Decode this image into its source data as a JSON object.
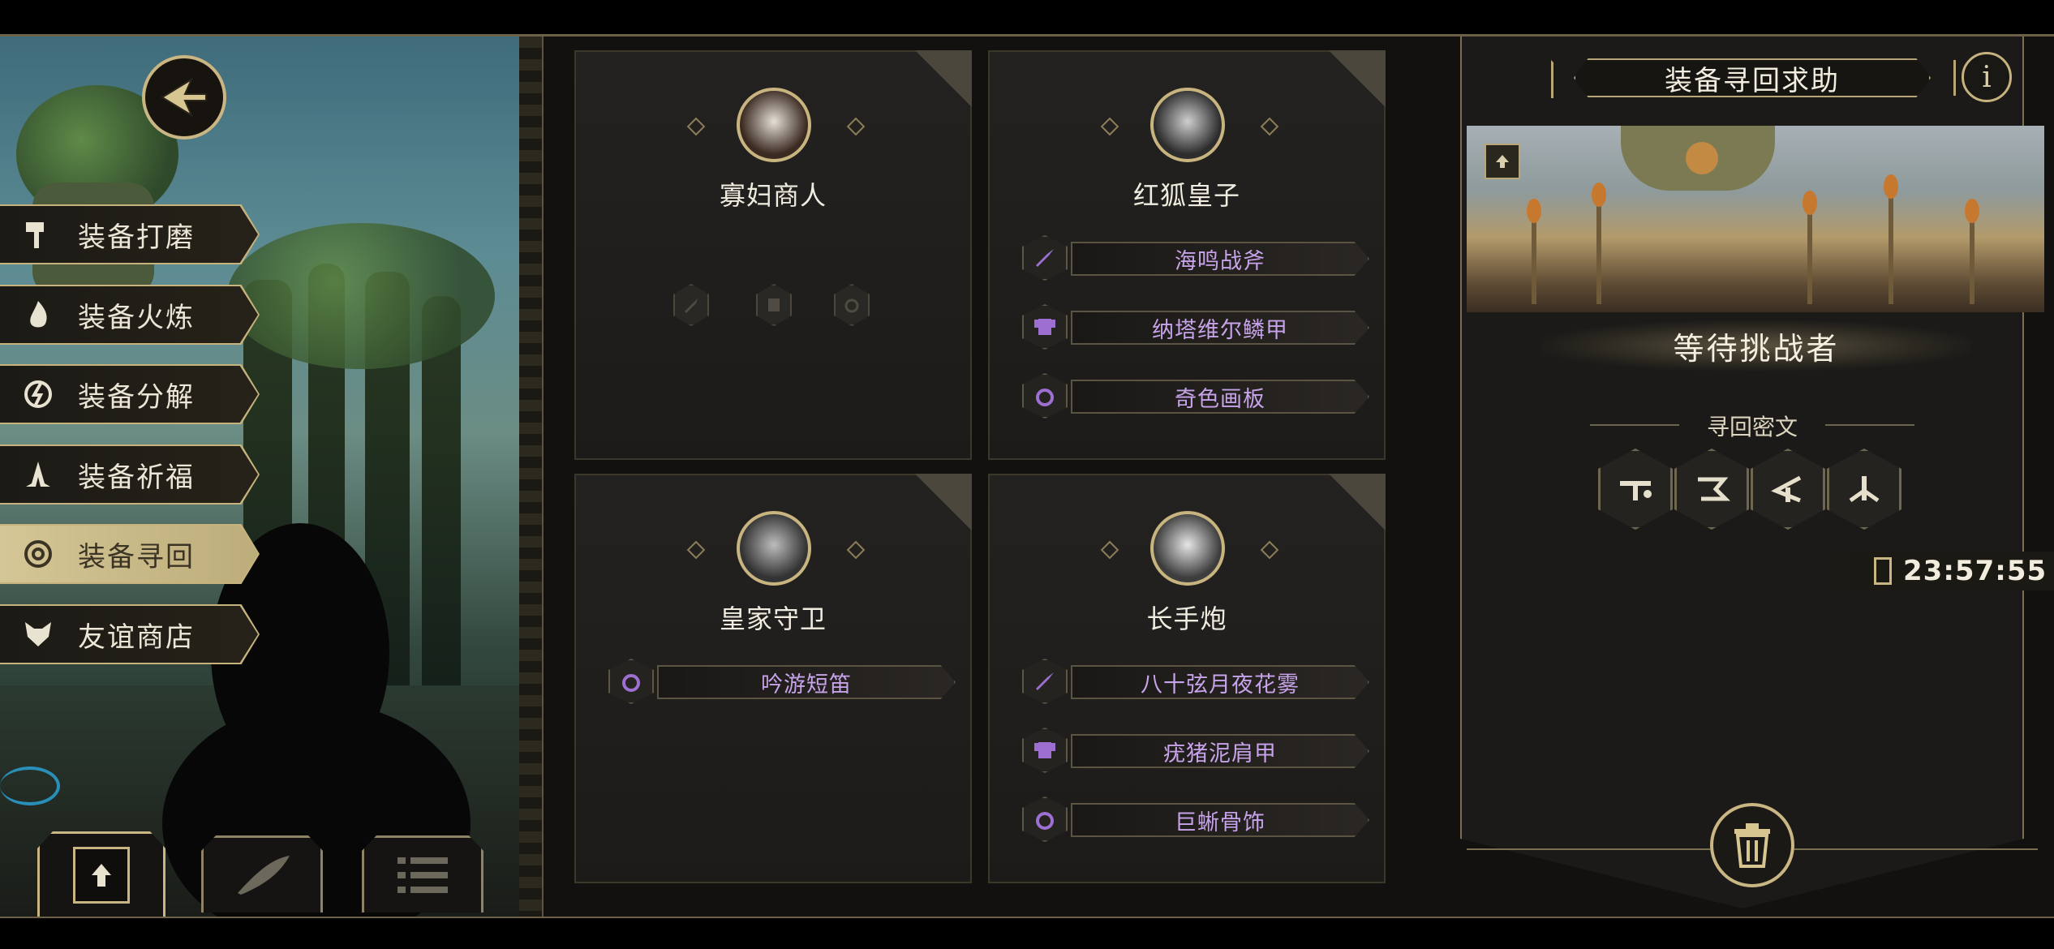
{
  "left_menu": {
    "items": [
      {
        "label": "装备打磨",
        "icon": "hammer-icon"
      },
      {
        "label": "装备火炼",
        "icon": "flame-icon"
      },
      {
        "label": "装备分解",
        "icon": "split-icon"
      },
      {
        "label": "装备祈福",
        "icon": "pray-hands-icon"
      },
      {
        "label": "装备寻回",
        "icon": "target-icon",
        "active": true
      },
      {
        "label": "友谊商店",
        "icon": "fox-icon"
      }
    ]
  },
  "cards": [
    {
      "name": "寡妇商人",
      "items": []
    },
    {
      "name": "红狐皇子",
      "items": [
        {
          "label": "海鸣战斧",
          "type": "sword-icon"
        },
        {
          "label": "纳塔维尔鳞甲",
          "type": "armor-icon"
        },
        {
          "label": "奇色画板",
          "type": "ring-icon"
        }
      ]
    },
    {
      "name": "皇家守卫",
      "items": [
        {
          "label": "吟游短笛",
          "type": "ring-icon"
        }
      ]
    },
    {
      "name": "长手炮",
      "items": [
        {
          "label": "八十弦月夜花雾",
          "type": "sword-icon"
        },
        {
          "label": "疣猪泥肩甲",
          "type": "armor-icon"
        },
        {
          "label": "巨蜥骨饰",
          "type": "ring-icon"
        }
      ]
    }
  ],
  "right_panel": {
    "title": "装备寻回求助",
    "info_label": "i",
    "status": "等待挑战者",
    "rune_title": "寻回密文",
    "timer": "23:57:55"
  },
  "colors": {
    "accent": "#c9b683",
    "equip_text": "#c7a3ea",
    "background": "#12110f"
  }
}
